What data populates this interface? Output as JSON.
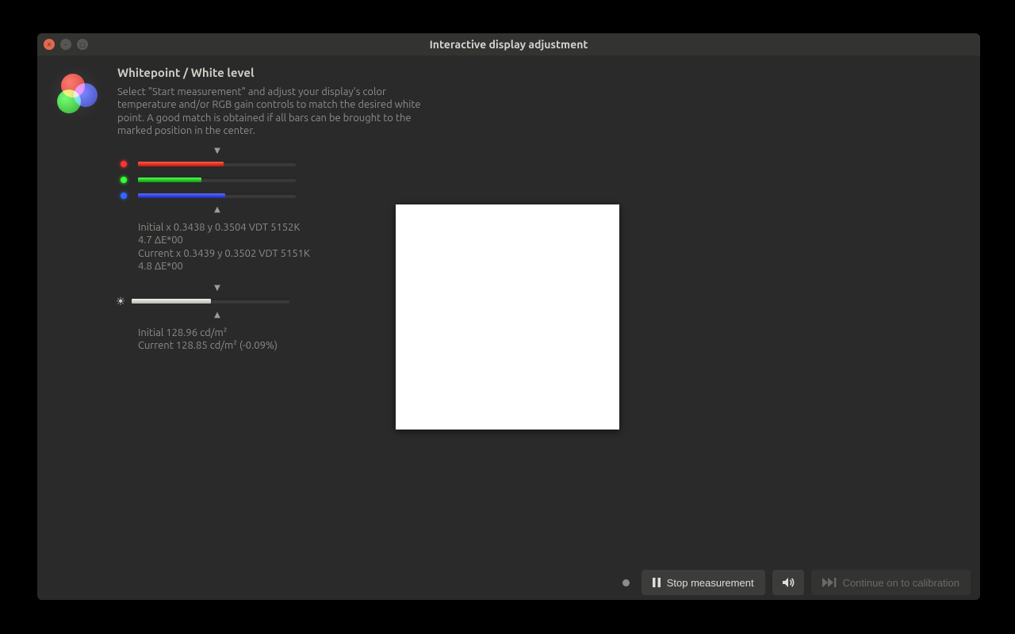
{
  "window": {
    "title": "Interactive display adjustment"
  },
  "header": {
    "title": "Whitepoint / White level",
    "description": "Select \"Start measurement\" and adjust your display's color temperature and/or RGB gain controls to match the desired white point. A good match is obtained if all bars can be brought to the marked position in the center."
  },
  "bars": {
    "red_pct": 54,
    "green_pct": 40,
    "blue_pct": 55,
    "white_pct": 50,
    "arrow_down": "▼",
    "arrow_up": "▲"
  },
  "readings": {
    "color_initial": "Initial x 0.3438 y 0.3504 VDT 5152K 4.7 ΔE*00",
    "color_current": "Current x 0.3439 y 0.3502 VDT 5151K 4.8 ΔE*00",
    "lum_initial": "Initial 128.96 cd/m²",
    "lum_current": "Current 128.85 cd/m² (-0.09%)"
  },
  "buttons": {
    "stop": "Stop measurement",
    "continue": "Continue on to calibration"
  }
}
